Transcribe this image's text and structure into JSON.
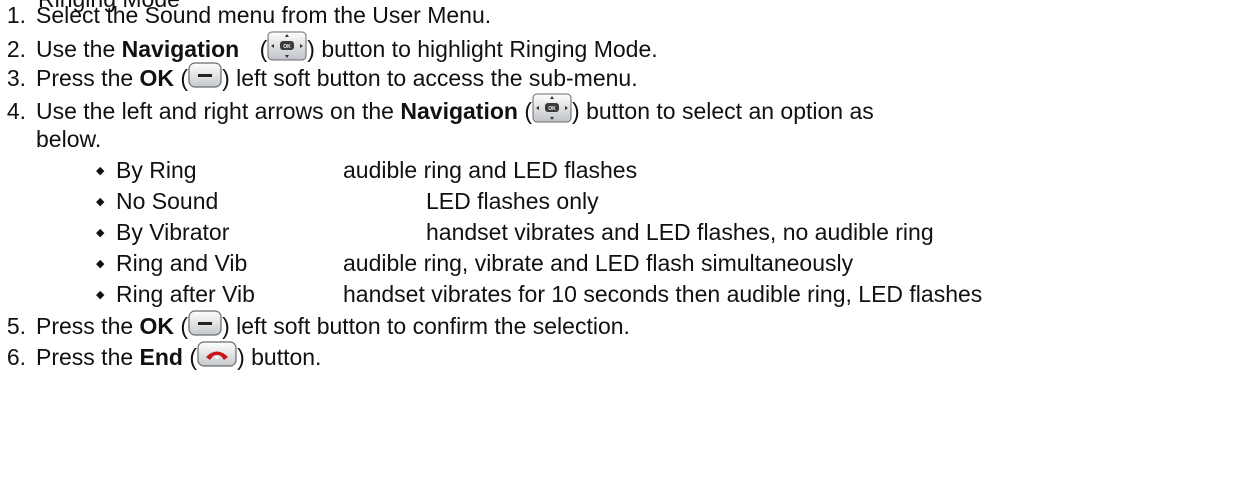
{
  "clipped_heading": "Ringing Mode",
  "steps": [
    {
      "number": "1.",
      "parts": [
        "Select the Sound menu from the User Menu."
      ]
    },
    {
      "number": "2.",
      "pre": "Use the ",
      "bold": "Navigation",
      "mid": " (",
      "post": ") button to highlight Ringing Mode."
    },
    {
      "number": "3.",
      "pre": "Press the ",
      "bold": "OK",
      "mid": " (",
      "post": ") left soft button to access the sub-menu."
    },
    {
      "number": "4.",
      "pre": "Use the left and right arrows on the ",
      "bold": "Navigation",
      "mid": " (",
      "post": ") button to select an option as",
      "cont": "below."
    },
    {
      "number": "5.",
      "pre": "Press the ",
      "bold": "OK",
      "mid": " (",
      "post": ") left soft button to confirm the selection."
    },
    {
      "number": "6.",
      "pre": "Press the ",
      "bold": "End",
      "mid": " (",
      "post": ") button."
    }
  ],
  "options": [
    {
      "name": "By Ring",
      "description": "audible ring and LED flashes"
    },
    {
      "name": "No Sound",
      "description": "LED flashes only"
    },
    {
      "name": "By Vibrator",
      "description": "handset vibrates and LED flashes, no audible ring"
    },
    {
      "name": "Ring and Vib",
      "description": "audible ring, vibrate and LED flash simultaneously"
    },
    {
      "name": "Ring after Vib",
      "description": "handset vibrates for 10 seconds then audible ring, LED flashes"
    }
  ],
  "icons": {
    "navigation": "navigation-ok-key-icon",
    "soft_key": "left-soft-key-icon",
    "end_key": "end-call-key-icon"
  },
  "colors": {
    "text": "#111111",
    "end_key": "#c8141b",
    "key_border": "#6a6a6a"
  }
}
